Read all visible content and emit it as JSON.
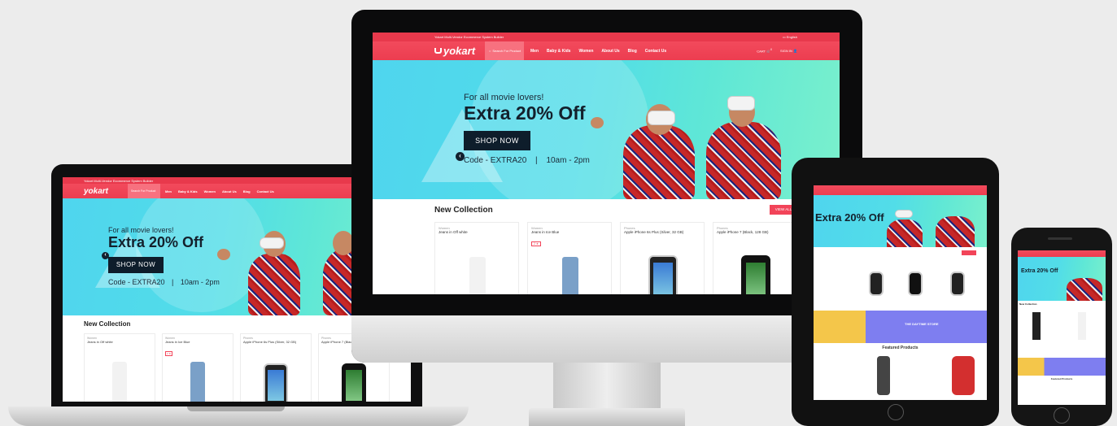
{
  "site": {
    "tagline": "Yokart Multi-Vendor Ecommerce System Builder",
    "language": "English",
    "logo_text": "yokart",
    "search_placeholder": "Search For Product",
    "menu": [
      "Men",
      "Baby & Kids",
      "Women",
      "About Us",
      "Blog",
      "Contact Us"
    ],
    "cart_label": "CART",
    "cart_count": "0",
    "signin_label": "SIGN IN",
    "brand_color": "#f24459"
  },
  "hero": {
    "subtitle": "For all movie lovers!",
    "title": "Extra 20% Off",
    "button": "SHOP NOW",
    "code": "Code - EXTRA20",
    "separator": "|",
    "time": "10am - 2pm",
    "prev_icon": "‹",
    "next_icon": "›"
  },
  "collection": {
    "title": "New Collection",
    "view_all": "VIEW ALL",
    "products": [
      {
        "category": "Women",
        "name": "Jeans in Off white"
      },
      {
        "category": "Women",
        "name": "Jeans in Ice Blue",
        "badge": "2 ★"
      },
      {
        "category": "Phones",
        "name": "Apple iPhone 6s Plus (Silver, 32 GB)"
      },
      {
        "category": "Phones",
        "name": "Apple iPhone 7 (Black, 128 GB)"
      }
    ]
  },
  "laptop_products": [
    {
      "category": "Women",
      "name": "Jeans in Off white"
    },
    {
      "category": "Women",
      "name": "Jeans in Ice Blue",
      "badge": "2 ★"
    },
    {
      "category": "Phones",
      "name": "Apple iPhone 6s Plus (Silver, 32 GB)"
    },
    {
      "category": "Phones",
      "name": "Apple iPhone 7 (Blac"
    }
  ],
  "tablet": {
    "promo_title": "THE DAYTIME STORE",
    "featured": "Featured Products"
  },
  "phone": {
    "featured": "Featured Products"
  }
}
